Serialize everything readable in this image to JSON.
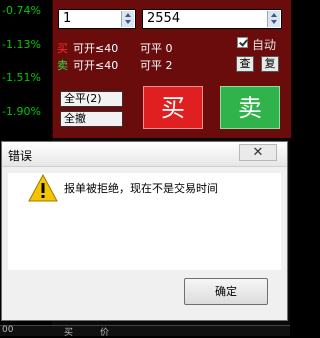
{
  "pct_column": [
    "-0.74%",
    "-1.13%",
    "-1.51%",
    "-1.90%"
  ],
  "order_panel": {
    "quantity_value": "1",
    "price_value": "2554",
    "buy_row": {
      "side": "买",
      "open_label": "可开≤40",
      "close_label": "可平 0"
    },
    "sell_row": {
      "side": "卖",
      "open_label": "可开≤40",
      "close_label": "可平 2"
    },
    "auto_label": "自动",
    "auto_checked": true,
    "query_label": "查",
    "reset_label": "复",
    "close_all_label": "全平(2)",
    "cancel_all_label": "全撤",
    "buy_label": "买",
    "sell_label": "卖"
  },
  "dialog": {
    "title": "错误",
    "close_symbol": "✕",
    "message": "报单被拒绝，现在不是交易时间",
    "ok_label": "确定"
  },
  "bottom_bar": {
    "left": "00",
    "col1": "买",
    "col2": "价"
  }
}
